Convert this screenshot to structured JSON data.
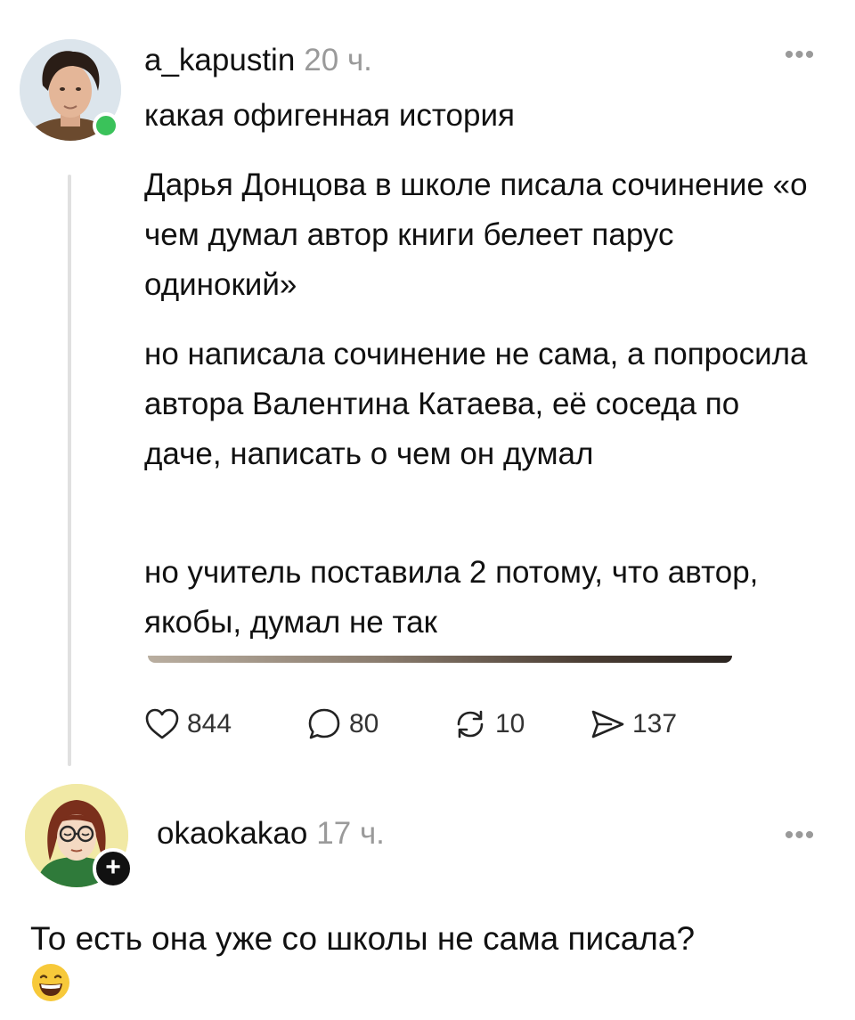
{
  "post": {
    "author": "a_kapustin",
    "time": "20 ч.",
    "first_line": "какая офигенная история",
    "paragraphs": [
      "Дарья Донцова в школе писала сочинение «о чем думал автор книги белеет парус одинокий»",
      "но написала сочинение не сама, а попросила автора Валентина Катаева, её соседа по даче, написать о чем он думал",
      "но учитель поставила 2 потому, что автор, якобы, думал не так"
    ],
    "actions": {
      "likes": "844",
      "comments": "80",
      "reposts": "10",
      "shares": "137"
    },
    "more_icon": "ellipsis-icon",
    "status_color": "#3ac25a"
  },
  "reply": {
    "author": "okaokakao",
    "time": "17 ч.",
    "text": "То есть она уже со школы не сама писала?",
    "emoji": "grinning-sweat-emoji",
    "follow_icon": "plus-icon"
  }
}
